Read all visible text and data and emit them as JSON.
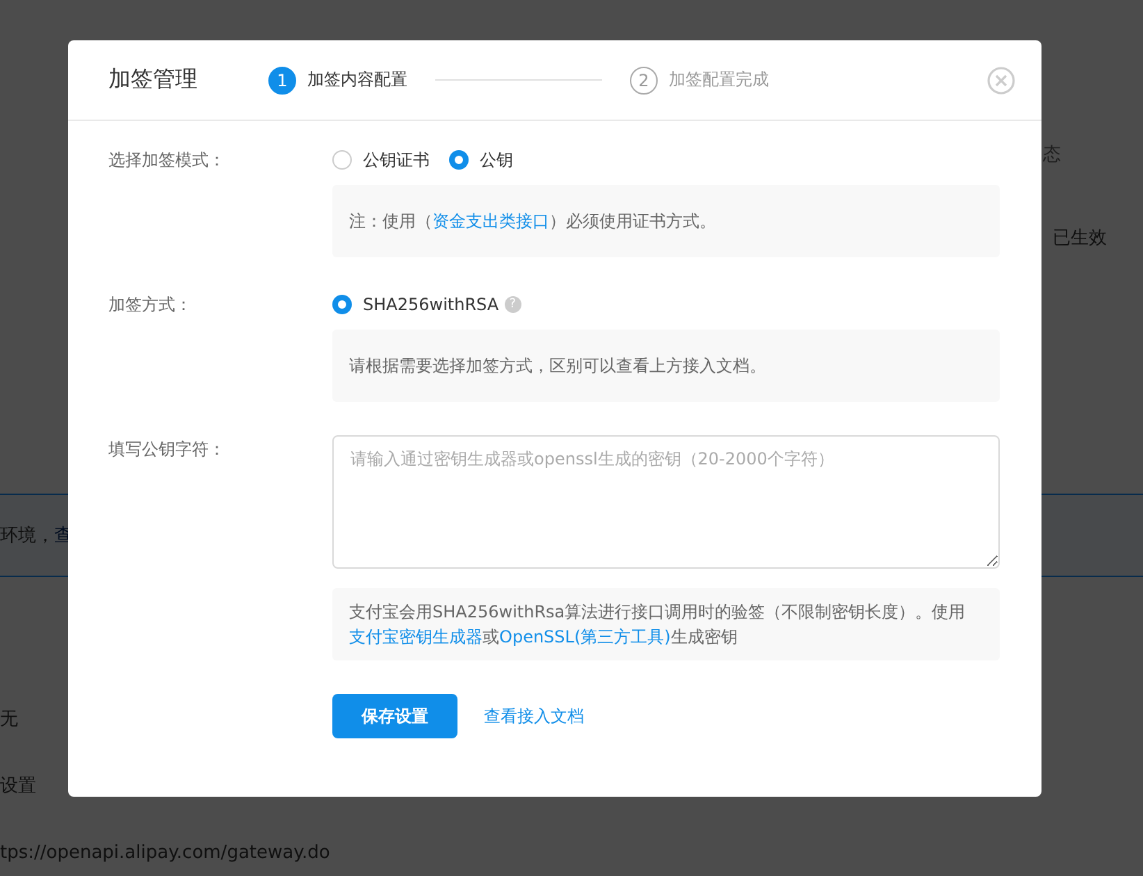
{
  "background_page": {
    "column_header": "态",
    "status": "已生效",
    "notice": [
      {
        "text": "环境，",
        "kind": "text"
      },
      {
        "text": "查",
        "kind": "link"
      }
    ],
    "row_value": "无",
    "row_label": "设置",
    "gateway_url": "tps://openapi.alipay.com/gateway.do"
  },
  "dialog": {
    "title": "加签管理",
    "steps": [
      {
        "number": "1",
        "label": "加签内容配置",
        "selected": true
      },
      {
        "number": "2",
        "label": "加签配置完成",
        "selected": false
      }
    ],
    "form": [
      {
        "kind": "radio",
        "label": "选择加签模式：",
        "options": [
          {
            "label": "公钥证书",
            "selected": false
          },
          {
            "label": "公钥",
            "selected": true
          }
        ],
        "note": [
          {
            "text": "注：使用（",
            "kind": "text"
          },
          {
            "text": "资金支出类接口",
            "kind": "link"
          },
          {
            "text": "）必须使用证书方式。",
            "kind": "text"
          }
        ]
      },
      {
        "kind": "radio",
        "label": "加签方式：",
        "options": [
          {
            "label": "SHA256withRSA",
            "selected": true,
            "help": "?"
          }
        ],
        "note": [
          {
            "text": "请根据需要选择加签方式，区别可以查看上方接入文档。",
            "kind": "text"
          }
        ]
      },
      {
        "kind": "textarea",
        "label": "填写公钥字符：",
        "placeholder": "请输入通过密钥生成器或openssl生成的密钥（20-2000个字符）",
        "note": [
          {
            "text": "支付宝会用SHA256withRsa算法进行接口调用时的验签（不限制密钥长度）。使用",
            "kind": "text"
          },
          {
            "text": "支付宝密钥生成器",
            "kind": "link"
          },
          {
            "text": "或",
            "kind": "text"
          },
          {
            "text": "OpenSSL(第三方工具)",
            "kind": "link"
          },
          {
            "text": "生成密钥",
            "kind": "text"
          }
        ]
      }
    ],
    "buttons": [
      {
        "label": "保存设置",
        "kind": "primary"
      },
      {
        "label": "查看接入文档",
        "kind": "link"
      }
    ]
  }
}
